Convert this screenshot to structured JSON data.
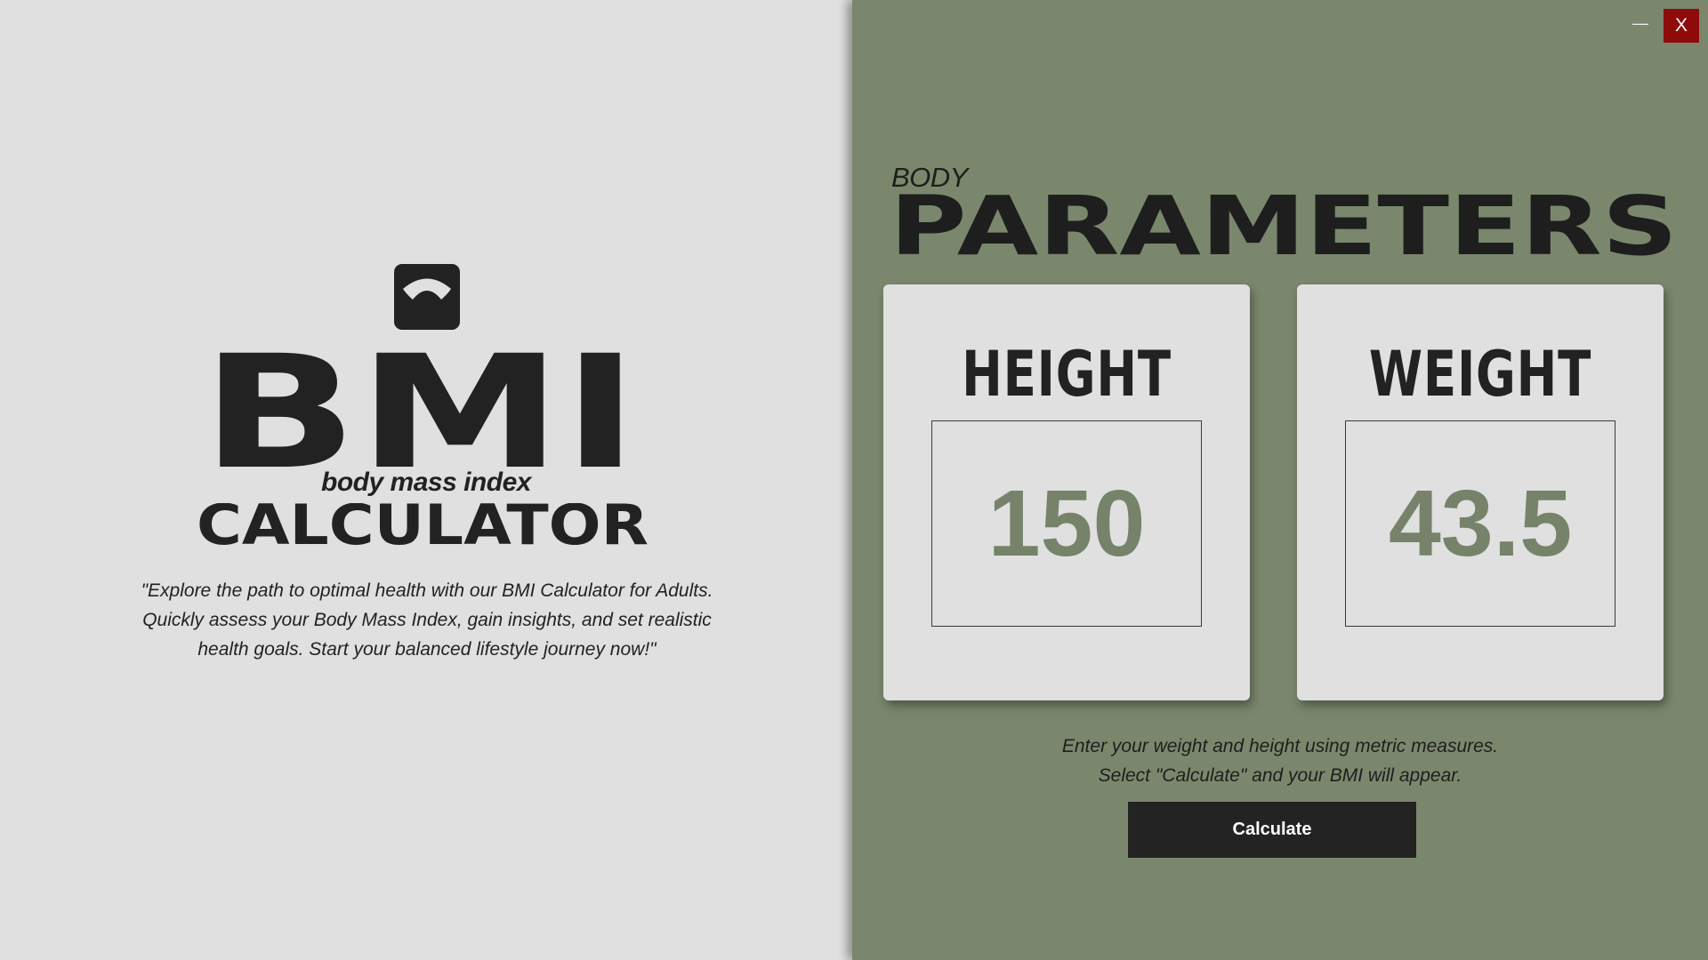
{
  "left": {
    "logo_text": "BMI",
    "subtitle": "body mass index",
    "calculator_word": "CALCULATOR",
    "tagline_lines": [
      "\"Explore the path to optimal health with our BMI Calculator for Adults.",
      "Quickly assess your Body Mass Index, gain insights, and set realistic",
      "health goals. Start your balanced lifestyle journey now!\""
    ],
    "icon": "bathroom-scale-icon"
  },
  "window": {
    "minimize_label": "—",
    "close_label": "X",
    "close_color": "#8f0b0b"
  },
  "right": {
    "body_label": "BODY",
    "title": "PARAMETERS",
    "height_card": {
      "title": "HEIGHT",
      "value": "150"
    },
    "weight_card": {
      "title": "WEIGHT",
      "value": "43.5"
    },
    "instructions_lines": [
      "Enter your weight and height using metric measures.",
      "Select \"Calculate\" and your BMI will appear."
    ],
    "calculate_label": "Calculate"
  },
  "colors": {
    "left_background": "#e0e0e0",
    "right_background": "#7a876c",
    "accent_value": "#76836a",
    "dark": "#222222"
  }
}
